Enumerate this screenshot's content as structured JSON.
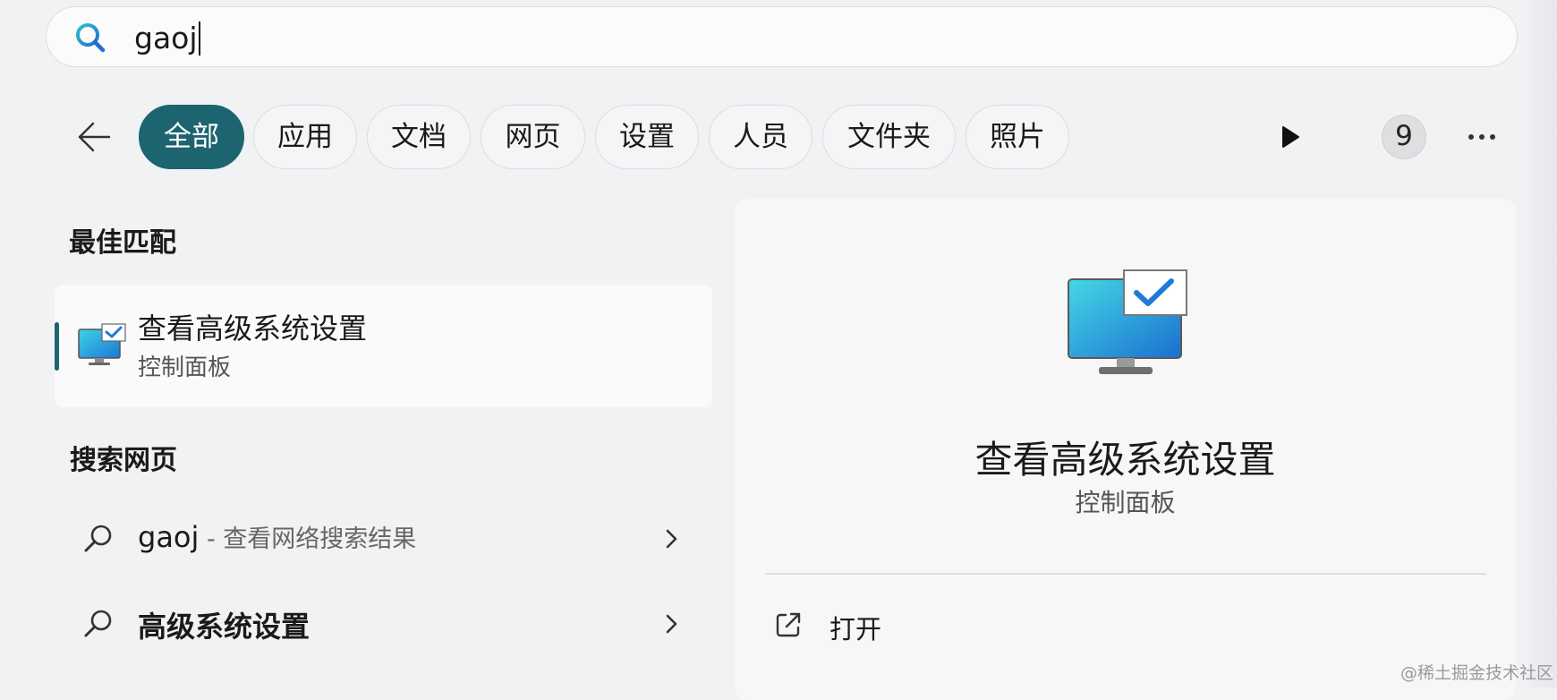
{
  "search": {
    "value": "gaoj"
  },
  "filters": {
    "tabs": [
      {
        "label": "全部",
        "active": true
      },
      {
        "label": "应用",
        "active": false
      },
      {
        "label": "文档",
        "active": false
      },
      {
        "label": "网页",
        "active": false
      },
      {
        "label": "设置",
        "active": false
      },
      {
        "label": "人员",
        "active": false
      },
      {
        "label": "文件夹",
        "active": false
      },
      {
        "label": "照片",
        "active": false
      }
    ],
    "count_badge": "9"
  },
  "best_match": {
    "heading": "最佳匹配",
    "title": "查看高级系统设置",
    "subtitle": "控制面板"
  },
  "web_search": {
    "heading": "搜索网页",
    "items": [
      {
        "query": "gaoj",
        "suffix": " - 查看网络搜索结果"
      },
      {
        "query": "高级系统设置",
        "suffix": ""
      }
    ]
  },
  "preview": {
    "title": "查看高级系统设置",
    "subtitle": "控制面板",
    "actions": [
      {
        "label": "打开",
        "icon": "open-external-icon"
      }
    ]
  },
  "watermark": "@稀土掘金技术社区",
  "colors": {
    "accent": "#1c6470",
    "background": "#f1f2f4"
  }
}
